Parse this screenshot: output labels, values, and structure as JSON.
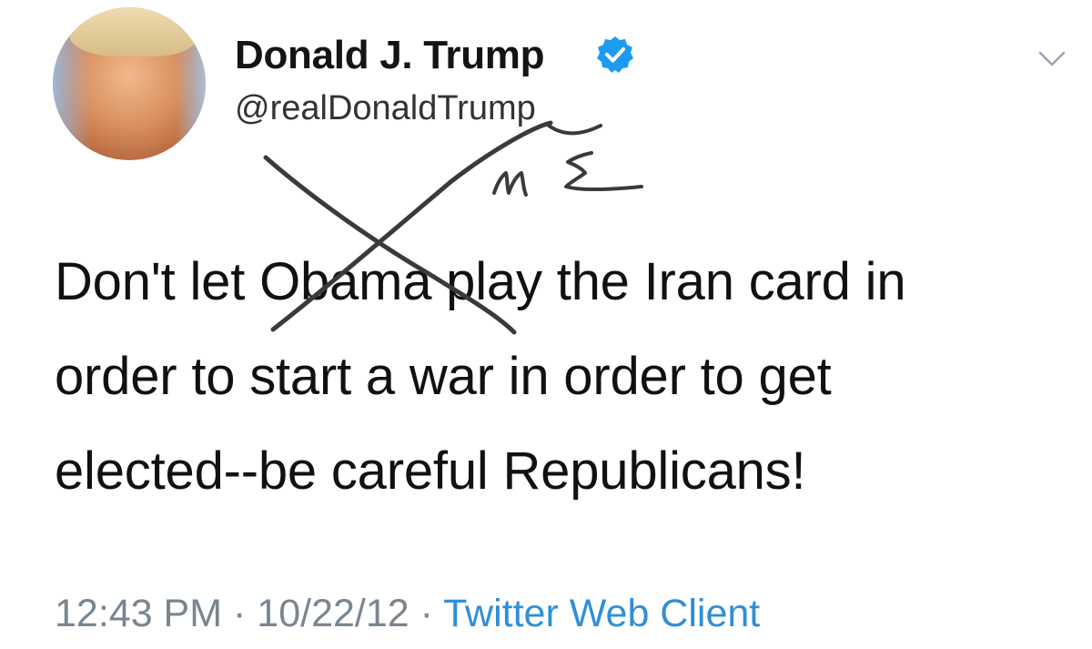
{
  "author": {
    "name": "Donald J. Trump",
    "handle": "@realDonaldTrump",
    "verified": true
  },
  "icons": {
    "avatar": "avatar-photo",
    "verified": "verified-badge-icon",
    "menu": "chevron-down-icon"
  },
  "tweet": {
    "lines": [
      "Don't let Obama play the Iran card in",
      "order to start a war in order to get",
      "elected--be careful Republicans!"
    ]
  },
  "annotation": {
    "handwritten_text": "ME"
  },
  "meta": {
    "time": "12:43 PM",
    "separator": "·",
    "date": "10/22/12",
    "client": "Twitter Web Client"
  },
  "colors": {
    "verified_blue": "#1d9bf0",
    "client_link": "#2f8fd6",
    "meta_gray": "#7a8590",
    "scribble": "#3a3a3a"
  }
}
